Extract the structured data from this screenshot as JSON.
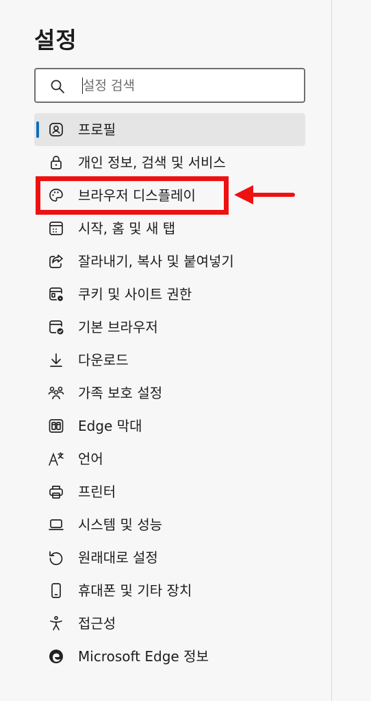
{
  "header": {
    "title": "설정"
  },
  "search": {
    "placeholder": "설정 검색",
    "value": ""
  },
  "nav": {
    "items": [
      {
        "label": "프로필",
        "icon": "profile-icon",
        "active": true
      },
      {
        "label": "개인 정보, 검색 및 서비스",
        "icon": "lock-icon"
      },
      {
        "label": "브라우저 디스플레이",
        "icon": "palette-icon"
      },
      {
        "label": "시작, 홈 및 새 탭",
        "icon": "start-home-icon"
      },
      {
        "label": "잘라내기, 복사 및 붙여넣기",
        "icon": "share-icon"
      },
      {
        "label": "쿠키 및 사이트 권한",
        "icon": "cookie-permission-icon"
      },
      {
        "label": "기본 브라우저",
        "icon": "default-browser-icon"
      },
      {
        "label": "다운로드",
        "icon": "download-icon"
      },
      {
        "label": "가족 보호 설정",
        "icon": "family-icon"
      },
      {
        "label": "Edge 막대",
        "icon": "edge-bar-icon"
      },
      {
        "label": "언어",
        "icon": "language-icon"
      },
      {
        "label": "프린터",
        "icon": "printer-icon"
      },
      {
        "label": "시스템 및 성능",
        "icon": "laptop-icon"
      },
      {
        "label": "원래대로 설정",
        "icon": "reset-icon"
      },
      {
        "label": "휴대폰 및 기타 장치",
        "icon": "phone-icon"
      },
      {
        "label": "접근성",
        "icon": "accessibility-icon"
      },
      {
        "label": "Microsoft Edge 정보",
        "icon": "edge-logo-icon"
      }
    ]
  },
  "annotation": {
    "highlight_color": "#ee1111"
  },
  "colors": {
    "accent": "#0f6cbd",
    "active_bg": "#e5e5e5",
    "background": "#f7f7f7"
  }
}
